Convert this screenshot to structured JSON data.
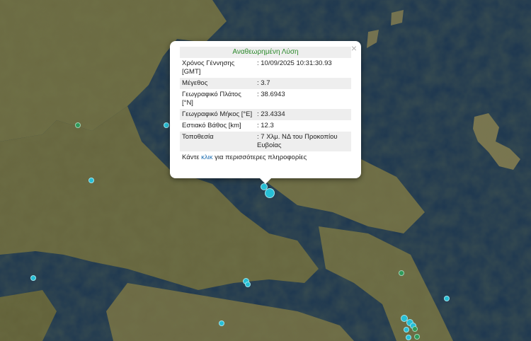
{
  "popup": {
    "title": "Αναθεωρημένη Λύση",
    "close_symbol": "×",
    "rows": [
      {
        "label": "Χρόνος Γέννησης [GMT]",
        "value": ": 10/09/2025 10:31:30.93"
      },
      {
        "label": "Μέγεθος",
        "value": ": 3.7"
      },
      {
        "label": "Γεωγραφικό Πλάτος [°N]",
        "value": ": 38.6943"
      },
      {
        "label": "Γεωγραφικό Μήκος [°E]",
        "value": ": 23.4334"
      },
      {
        "label": "Εστιακό Βάθος [km]",
        "value": ": 12.3"
      },
      {
        "label": "Τοποθεσία",
        "value": ": 7 Χλμ. ΝΔ του Προκοπίου Ευβοίας"
      }
    ],
    "more_prefix": "Κάντε",
    "more_link": "κλικ",
    "more_suffix": "για περισσότερες πληροφορίες"
  },
  "colors": {
    "sea": "#1b3550",
    "land": "#6b6a42",
    "marker_recent": "#26bfd6",
    "marker_old": "#2e9a5a",
    "title_green": "#2d8a2d",
    "link_blue": "#1f6fb2"
  }
}
